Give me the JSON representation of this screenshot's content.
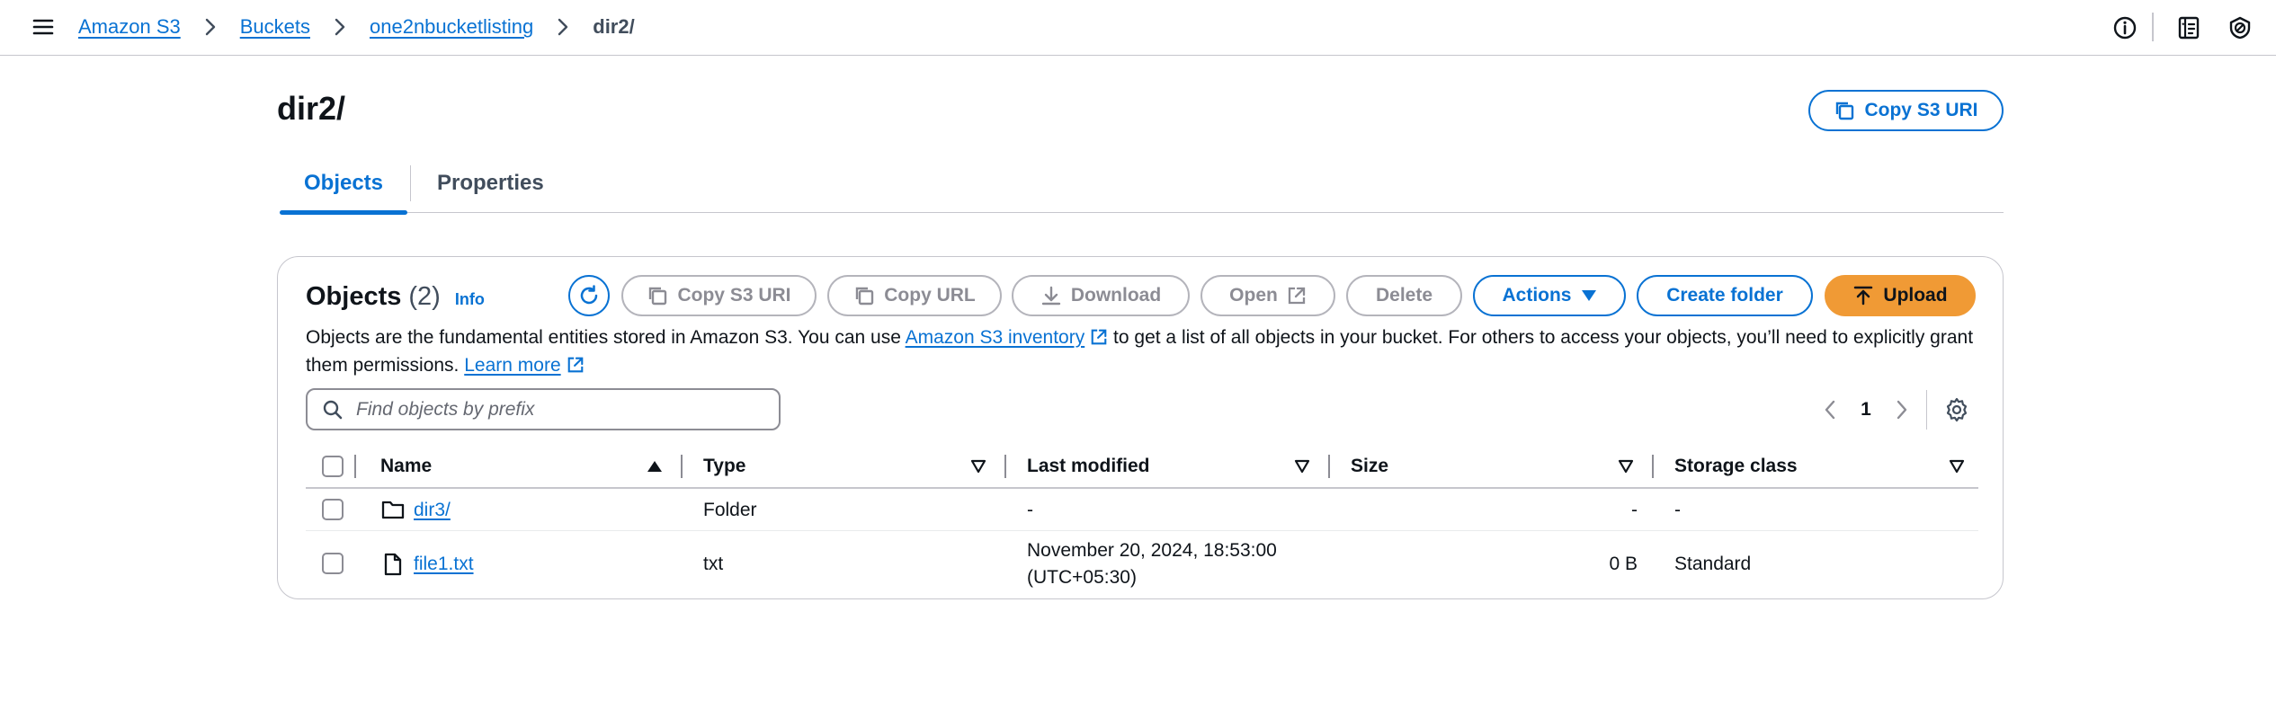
{
  "breadcrumb": {
    "items": [
      "Amazon S3",
      "Buckets",
      "one2nbucketlisting"
    ],
    "current": "dir2/"
  },
  "header": {
    "title": "dir2/",
    "copy_uri_label": "Copy S3 URI"
  },
  "tabs": [
    {
      "label": "Objects",
      "selected": true
    },
    {
      "label": "Properties",
      "selected": false
    }
  ],
  "objects_panel": {
    "title": "Objects",
    "count": "(2)",
    "info_label": "Info",
    "buttons": {
      "copy_s3_uri": "Copy S3 URI",
      "copy_url": "Copy URL",
      "download": "Download",
      "open": "Open",
      "delete": "Delete",
      "actions": "Actions",
      "create_folder": "Create folder",
      "upload": "Upload"
    },
    "description": {
      "part1": "Objects are the fundamental entities stored in Amazon S3. You can use ",
      "inventory_link": "Amazon S3 inventory",
      "part2": " to get a list of all objects in your bucket. For others to access your objects, you’ll need to explicitly grant them permissions. ",
      "learn_more": "Learn more"
    },
    "search": {
      "placeholder": "Find objects by prefix",
      "value": ""
    },
    "pagination": {
      "current_page": "1"
    }
  },
  "table": {
    "columns": [
      "Name",
      "Type",
      "Last modified",
      "Size",
      "Storage class"
    ],
    "rows": [
      {
        "icon": "folder-icon",
        "name": "dir3/",
        "type": "Folder",
        "last_modified_line1": "-",
        "last_modified_line2": "",
        "size": "-",
        "storage_class": "-"
      },
      {
        "icon": "file-icon",
        "name": "file1.txt",
        "type": "txt",
        "last_modified_line1": "November 20, 2024, 18:53:00",
        "last_modified_line2": "(UTC+05:30)",
        "size": "0 B",
        "storage_class": "Standard"
      }
    ]
  },
  "colors": {
    "link": "#0972d3",
    "upload_button": "#f09a35",
    "disabled": "#8c8c94"
  }
}
